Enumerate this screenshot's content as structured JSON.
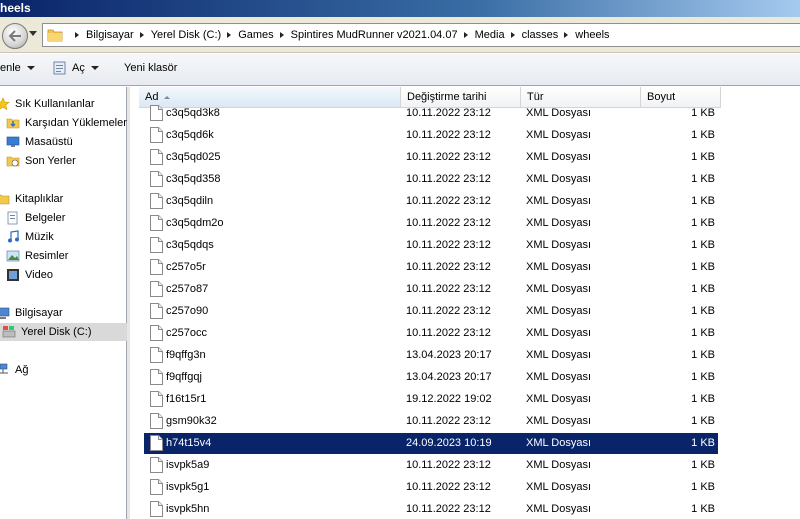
{
  "window": {
    "title": "heels"
  },
  "address": {
    "crumbs": [
      "Bilgisayar",
      "Yerel Disk (C:)",
      "Games",
      "Spintires MudRunner v2021.04.07",
      "Media",
      "classes",
      "wheels"
    ]
  },
  "toolbar": {
    "organize_label": "enle",
    "open_label": "Aç",
    "new_folder_label": "Yeni klasör"
  },
  "nav": {
    "favorites_header": "Sık Kullanılanlar",
    "downloads": "Karşıdan Yüklemeler",
    "desktop": "Masaüstü",
    "recent": "Son Yerler",
    "libraries_header": "Kitaplıklar",
    "documents": "Belgeler",
    "music": "Müzik",
    "pictures": "Resimler",
    "videos": "Video",
    "computer_header": "Bilgisayar",
    "local_disk": "Yerel Disk (C:)",
    "network_header": "Ağ"
  },
  "columns": {
    "name": "Ad",
    "date": "Değiştirme tarihi",
    "type": "Tür",
    "size": "Boyut"
  },
  "files": [
    {
      "name": "c3q5qd3k8",
      "date": "10.11.2022 23:12",
      "type": "XML Dosyası",
      "size": "1 KB"
    },
    {
      "name": "c3q5qd6k",
      "date": "10.11.2022 23:12",
      "type": "XML Dosyası",
      "size": "1 KB"
    },
    {
      "name": "c3q5qd025",
      "date": "10.11.2022 23:12",
      "type": "XML Dosyası",
      "size": "1 KB"
    },
    {
      "name": "c3q5qd358",
      "date": "10.11.2022 23:12",
      "type": "XML Dosyası",
      "size": "1 KB"
    },
    {
      "name": "c3q5qdiln",
      "date": "10.11.2022 23:12",
      "type": "XML Dosyası",
      "size": "1 KB"
    },
    {
      "name": "c3q5qdm2o",
      "date": "10.11.2022 23:12",
      "type": "XML Dosyası",
      "size": "1 KB"
    },
    {
      "name": "c3q5qdqs",
      "date": "10.11.2022 23:12",
      "type": "XML Dosyası",
      "size": "1 KB"
    },
    {
      "name": "c257o5r",
      "date": "10.11.2022 23:12",
      "type": "XML Dosyası",
      "size": "1 KB"
    },
    {
      "name": "c257o87",
      "date": "10.11.2022 23:12",
      "type": "XML Dosyası",
      "size": "1 KB"
    },
    {
      "name": "c257o90",
      "date": "10.11.2022 23:12",
      "type": "XML Dosyası",
      "size": "1 KB"
    },
    {
      "name": "c257occ",
      "date": "10.11.2022 23:12",
      "type": "XML Dosyası",
      "size": "1 KB"
    },
    {
      "name": "f9qffg3n",
      "date": "13.04.2023 20:17",
      "type": "XML Dosyası",
      "size": "1 KB"
    },
    {
      "name": "f9qffgqj",
      "date": "13.04.2023 20:17",
      "type": "XML Dosyası",
      "size": "1 KB"
    },
    {
      "name": "f16t15r1",
      "date": "19.12.2022 19:02",
      "type": "XML Dosyası",
      "size": "1 KB"
    },
    {
      "name": "gsm90k32",
      "date": "10.11.2022 23:12",
      "type": "XML Dosyası",
      "size": "1 KB"
    },
    {
      "name": "h74t15v4",
      "date": "24.09.2023 10:19",
      "type": "XML Dosyası",
      "size": "1 KB"
    },
    {
      "name": "isvpk5a9",
      "date": "10.11.2022 23:12",
      "type": "XML Dosyası",
      "size": "1 KB"
    },
    {
      "name": "isvpk5g1",
      "date": "10.11.2022 23:12",
      "type": "XML Dosyası",
      "size": "1 KB"
    },
    {
      "name": "isvpk5hn",
      "date": "10.11.2022 23:12",
      "type": "XML Dosyası",
      "size": "1 KB"
    }
  ],
  "selected_file": "h74t15v4",
  "colors": {
    "selection": "#0a246a",
    "titlebar": "#0a246a"
  }
}
